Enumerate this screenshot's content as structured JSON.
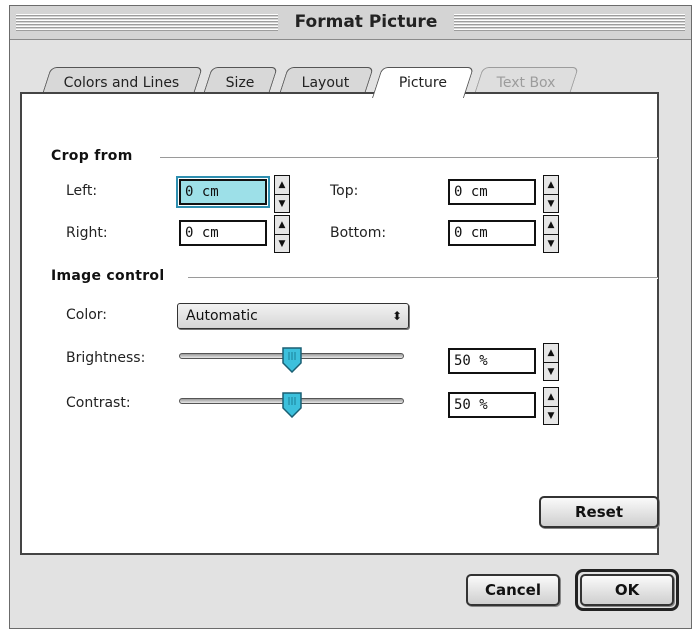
{
  "window": {
    "title": "Format Picture"
  },
  "tabs": [
    {
      "label": "Colors and Lines",
      "state": "normal"
    },
    {
      "label": "Size",
      "state": "normal"
    },
    {
      "label": "Layout",
      "state": "normal"
    },
    {
      "label": "Picture",
      "state": "active"
    },
    {
      "label": "Text Box",
      "state": "disabled"
    }
  ],
  "crop": {
    "title": "Crop from",
    "left": {
      "label": "Left:",
      "value": "0 cm"
    },
    "top": {
      "label": "Top:",
      "value": "0 cm"
    },
    "right": {
      "label": "Right:",
      "value": "0 cm"
    },
    "bottom": {
      "label": "Bottom:",
      "value": "0 cm"
    }
  },
  "image_control": {
    "title": "Image control",
    "color": {
      "label": "Color:",
      "selected": "Automatic"
    },
    "brightness": {
      "label": "Brightness:",
      "value": "50 %",
      "level": 0.5
    },
    "contrast": {
      "label": "Contrast:",
      "value": "50 %",
      "level": 0.5
    }
  },
  "buttons": {
    "reset": "Reset",
    "cancel": "Cancel",
    "ok": "OK"
  },
  "icons": {
    "stepper_up": "▲",
    "stepper_down": "▼",
    "select_arrow": "⬍"
  },
  "colors": {
    "focus": "#9de0e8",
    "slider_thumb": "#3cc0dc"
  }
}
